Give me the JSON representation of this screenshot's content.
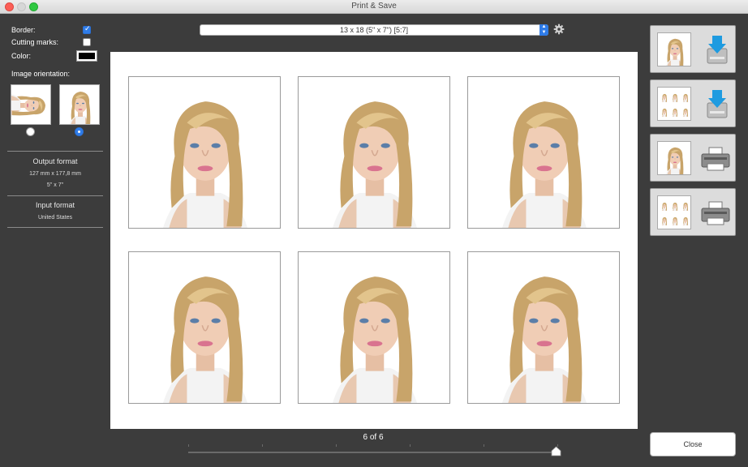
{
  "window": {
    "title": "Print & Save"
  },
  "options": {
    "border_label": "Border:",
    "border_checked": true,
    "cutting_marks_label": "Cutting marks:",
    "cutting_marks_checked": false,
    "color_label": "Color:",
    "color_value": "#000000",
    "orientation_label": "Image orientation:",
    "orientation_selected": "portrait"
  },
  "output_format": {
    "title": "Output format",
    "metric": "127 mm x 177,8 mm",
    "imperial": "5\" x 7\""
  },
  "input_format": {
    "title": "Input format",
    "value": "United States"
  },
  "format_select": {
    "value": "13 x 18 (5\" x 7\") [5:7]"
  },
  "preview": {
    "photo_count": 6
  },
  "pager": {
    "label": "6 of 6",
    "position": 1.0
  },
  "actions": [
    {
      "name": "save-single",
      "icon": "download-icon"
    },
    {
      "name": "save-sheet",
      "icon": "download-icon"
    },
    {
      "name": "print-single",
      "icon": "printer-icon"
    },
    {
      "name": "print-sheet",
      "icon": "printer-icon"
    }
  ],
  "buttons": {
    "close_label": "Close"
  },
  "colors": {
    "accent": "#2f7ce8",
    "panel_bg": "#3c3c3c"
  }
}
